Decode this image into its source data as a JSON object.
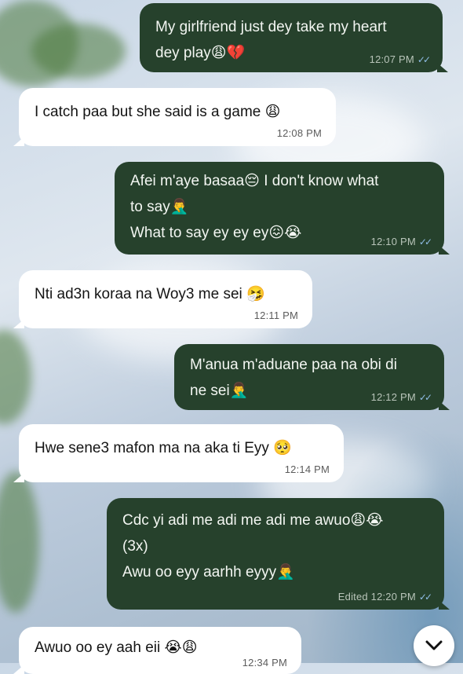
{
  "messages": [
    {
      "direction": "out",
      "lines": [
        "My girlfriend just dey take my heart",
        "dey play😩💔"
      ],
      "time": "12:07 PM",
      "ticks": "✓✓",
      "status": "read"
    },
    {
      "direction": "in",
      "lines": [
        "I catch paa but she said is a game 😩"
      ],
      "time": "12:08 PM"
    },
    {
      "direction": "out",
      "lines": [
        "Afei m'aye basaa😔 I don't know what",
        "to say🤦‍♂️",
        "What to say ey ey ey😖😭"
      ],
      "time": "12:10 PM",
      "ticks": "✓✓",
      "status": "read"
    },
    {
      "direction": "in",
      "lines": [
        "Nti ad3n koraa na Woy3 me sei 🤧"
      ],
      "time": "12:11 PM"
    },
    {
      "direction": "out",
      "lines": [
        "M'anua m'aduane paa na obi di",
        "ne sei🤦‍♂️"
      ],
      "time": "12:12 PM",
      "ticks": "✓✓",
      "status": "read"
    },
    {
      "direction": "in",
      "lines": [
        "Hwe sene3 mafon ma na aka ti Eyy 🥺"
      ],
      "time": "12:14 PM"
    },
    {
      "direction": "out",
      "lines": [
        "Cdc yi adi me adi me adi me awuo😩😭",
        "(3x)",
        "Awu oo eyy aarhh eyyy🤦‍♂️"
      ],
      "edited": "Edited",
      "time": "12:20 PM",
      "ticks": "✓✓",
      "status": "read"
    },
    {
      "direction": "in",
      "lines": [
        "Awuo oo ey aah eii 😭😩"
      ],
      "time": "12:34 PM"
    }
  ],
  "scroll_button": {
    "icon": "chevron-down-icon"
  },
  "colors": {
    "outgoing_bubble": "#26412c",
    "incoming_bubble": "#ffffff",
    "read_ticks": "#8fbde6"
  }
}
